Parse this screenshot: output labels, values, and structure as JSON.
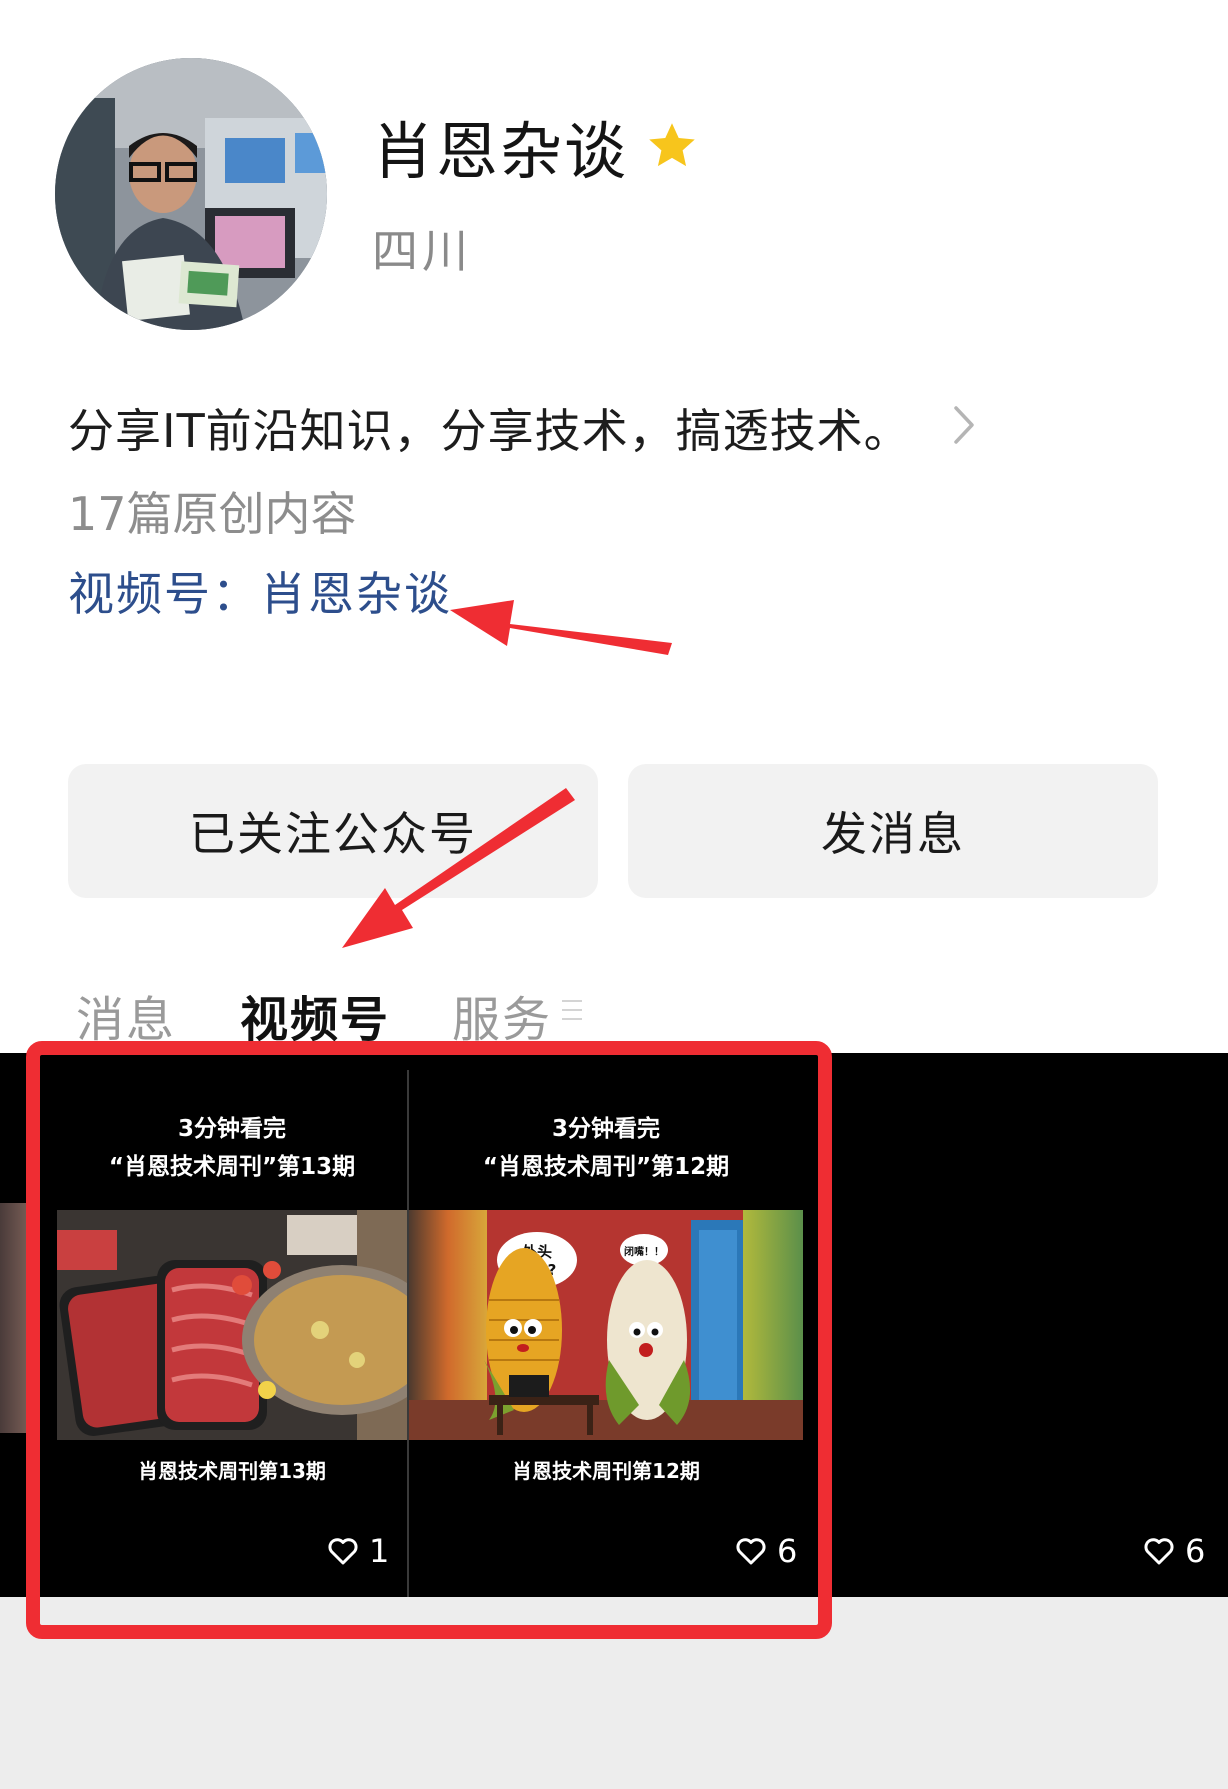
{
  "profile": {
    "name": "肖恩杂谈",
    "region": "四川",
    "bio": "分享IT前沿知识，分享技术，搞透技术。",
    "original_count": "17篇原创内容",
    "video_channel_link": "视频号：肖恩杂谈"
  },
  "actions": {
    "follow_label": "已关注公众号",
    "message_label": "发消息"
  },
  "tabs": [
    {
      "label": "消息",
      "active": false
    },
    {
      "label": "视频号",
      "active": true
    },
    {
      "label": "服务",
      "active": false
    }
  ],
  "videos": [
    {
      "title_line1": "3分钟看完",
      "title_line2": "“肖恩技术周刊”第13期",
      "subtitle": "肖恩技术周刊第13期",
      "likes": "1",
      "thumbnail": "hotpot-beef"
    },
    {
      "title_line1": "3分钟看完",
      "title_line2": "“肖恩技术周刊”第12期",
      "subtitle": "肖恩技术周刊第12期",
      "bubble_left": "外头热吗?",
      "bubble_right": "闭嘴！！",
      "likes": "6",
      "thumbnail": "corn-characters"
    },
    {
      "likes": "6",
      "thumbnail": "black"
    }
  ],
  "colors": {
    "link": "#2d4e8c",
    "annotation_red": "#ef2d33",
    "star": "#f7c51c",
    "button_bg": "#f2f2f2"
  }
}
